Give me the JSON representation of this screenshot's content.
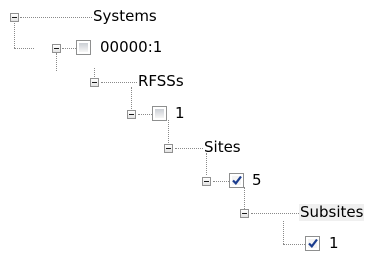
{
  "tree": {
    "nodes": [
      {
        "label": "Systems",
        "expanded": true,
        "has_checkbox": false
      },
      {
        "label": "00000:1",
        "expanded": true,
        "has_checkbox": true,
        "checked": false
      },
      {
        "label": "RFSSs",
        "expanded": true,
        "has_checkbox": false
      },
      {
        "label": "1",
        "expanded": true,
        "has_checkbox": true,
        "checked": false
      },
      {
        "label": "Sites",
        "expanded": true,
        "has_checkbox": false
      },
      {
        "label": "5",
        "expanded": true,
        "has_checkbox": true,
        "checked": true
      },
      {
        "label": "Subsites",
        "expanded": true,
        "has_checkbox": false,
        "highlighted": true
      },
      {
        "label": "1",
        "expanded": false,
        "has_checkbox": true,
        "checked": true
      }
    ]
  },
  "colors": {
    "checkmark": "#1b3d8f",
    "connector": "#8a8a8a",
    "selection": "#f0f0f0"
  },
  "icons": {
    "expander": "minus-box-icon",
    "check": "checkmark-icon"
  }
}
